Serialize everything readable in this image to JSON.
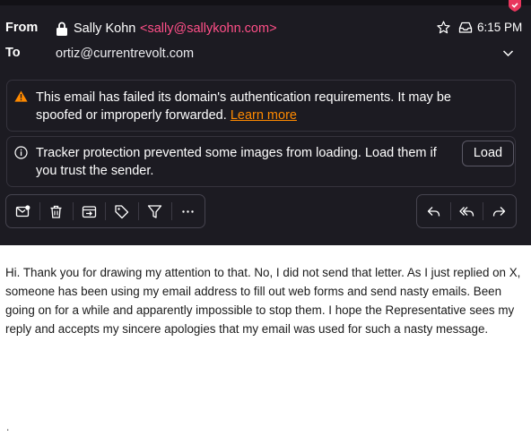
{
  "message": {
    "from_label": "From",
    "to_label": "To",
    "sender_name": "Sally Kohn",
    "sender_email": "<sally@sallykohn.com>",
    "recipient": "ortiz@currentrevolt.com",
    "time": "6:15 PM"
  },
  "warning_banner": {
    "text": "This email has failed its domain's authentication requirements. It may be spoofed or improperly forwarded.",
    "link": "Learn more"
  },
  "tracker_banner": {
    "text": "Tracker protection prevented some images from loading. Load them if you trust the sender.",
    "button": "Load"
  },
  "toolbar": {
    "left_icons": [
      "mark-unread-icon",
      "trash-icon",
      "move-to-folder-icon",
      "label-tag-icon",
      "filter-icon",
      "more-options-icon"
    ],
    "right_icons": [
      "reply-icon",
      "reply-all-icon",
      "forward-icon"
    ]
  },
  "body": {
    "text": "Hi. Thank you for drawing my attention to that. No, I did not send that letter. As I just replied on X, someone has been using my email address to fill out web forms and send nasty emails. Been going on for a while and apparently impossible to stop them. I hope the Representative sees my reply and accepts my sincere apologies that my email was used for such a nasty message.",
    "trailing": "."
  },
  "colors": {
    "header_bg": "#1c1b22",
    "sender_email": "#ff4f88",
    "link": "#ff8a00",
    "warning_icon": "#ff8a00",
    "badge": "#e8365d"
  }
}
